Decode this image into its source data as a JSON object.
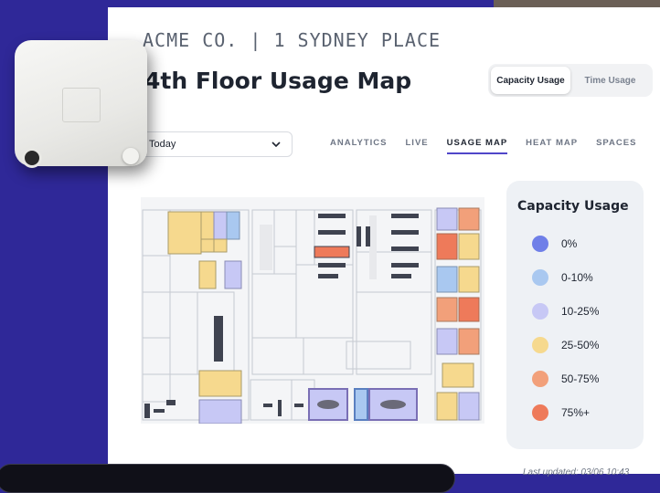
{
  "header": {
    "company": "ACME CO. | 1 SYDNEY PLACE",
    "title": "4th Floor Usage Map"
  },
  "toggle": {
    "options": [
      "Capacity Usage",
      "Time Usage"
    ],
    "selected": "Capacity Usage"
  },
  "date_filter": {
    "value": "Today"
  },
  "tabs": {
    "items": [
      "ANALYTICS",
      "LIVE",
      "USAGE MAP",
      "HEAT MAP",
      "SPACES"
    ],
    "active": "USAGE MAP"
  },
  "legend": {
    "title": "Capacity Usage",
    "items": [
      {
        "label": "0%",
        "color": "#6f7fe8"
      },
      {
        "label": "0-10%",
        "color": "#a9c8f0"
      },
      {
        "label": "10-25%",
        "color": "#c7c8f5"
      },
      {
        "label": "25-50%",
        "color": "#f6d98e"
      },
      {
        "label": "50-75%",
        "color": "#f2a07a"
      },
      {
        "label": "75%+",
        "color": "#ee7a5a"
      }
    ]
  },
  "footer": {
    "last_updated": "Last updated: 03/06 10:43"
  },
  "colors": {
    "accent": "#4f46c9",
    "background": "#2f2898"
  }
}
